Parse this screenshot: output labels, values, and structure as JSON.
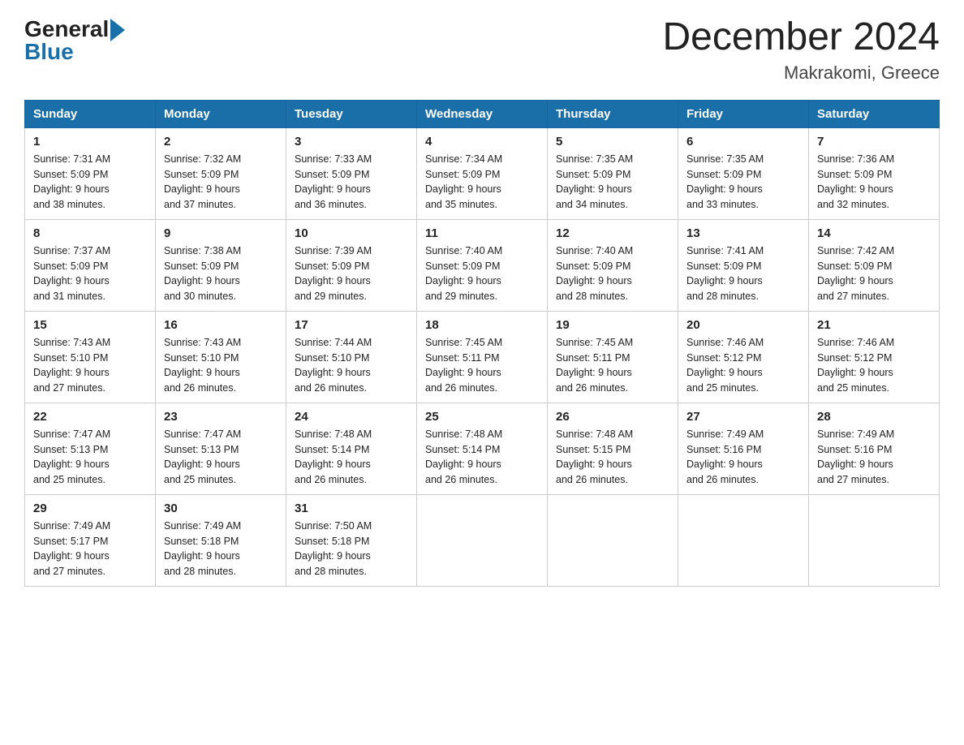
{
  "logo": {
    "general": "General",
    "blue": "Blue"
  },
  "title": "December 2024",
  "subtitle": "Makrakomi, Greece",
  "days_of_week": [
    "Sunday",
    "Monday",
    "Tuesday",
    "Wednesday",
    "Thursday",
    "Friday",
    "Saturday"
  ],
  "weeks": [
    [
      {
        "day": "1",
        "sunrise": "7:31 AM",
        "sunset": "5:09 PM",
        "daylight": "9 hours and 38 minutes."
      },
      {
        "day": "2",
        "sunrise": "7:32 AM",
        "sunset": "5:09 PM",
        "daylight": "9 hours and 37 minutes."
      },
      {
        "day": "3",
        "sunrise": "7:33 AM",
        "sunset": "5:09 PM",
        "daylight": "9 hours and 36 minutes."
      },
      {
        "day": "4",
        "sunrise": "7:34 AM",
        "sunset": "5:09 PM",
        "daylight": "9 hours and 35 minutes."
      },
      {
        "day": "5",
        "sunrise": "7:35 AM",
        "sunset": "5:09 PM",
        "daylight": "9 hours and 34 minutes."
      },
      {
        "day": "6",
        "sunrise": "7:35 AM",
        "sunset": "5:09 PM",
        "daylight": "9 hours and 33 minutes."
      },
      {
        "day": "7",
        "sunrise": "7:36 AM",
        "sunset": "5:09 PM",
        "daylight": "9 hours and 32 minutes."
      }
    ],
    [
      {
        "day": "8",
        "sunrise": "7:37 AM",
        "sunset": "5:09 PM",
        "daylight": "9 hours and 31 minutes."
      },
      {
        "day": "9",
        "sunrise": "7:38 AM",
        "sunset": "5:09 PM",
        "daylight": "9 hours and 30 minutes."
      },
      {
        "day": "10",
        "sunrise": "7:39 AM",
        "sunset": "5:09 PM",
        "daylight": "9 hours and 29 minutes."
      },
      {
        "day": "11",
        "sunrise": "7:40 AM",
        "sunset": "5:09 PM",
        "daylight": "9 hours and 29 minutes."
      },
      {
        "day": "12",
        "sunrise": "7:40 AM",
        "sunset": "5:09 PM",
        "daylight": "9 hours and 28 minutes."
      },
      {
        "day": "13",
        "sunrise": "7:41 AM",
        "sunset": "5:09 PM",
        "daylight": "9 hours and 28 minutes."
      },
      {
        "day": "14",
        "sunrise": "7:42 AM",
        "sunset": "5:09 PM",
        "daylight": "9 hours and 27 minutes."
      }
    ],
    [
      {
        "day": "15",
        "sunrise": "7:43 AM",
        "sunset": "5:10 PM",
        "daylight": "9 hours and 27 minutes."
      },
      {
        "day": "16",
        "sunrise": "7:43 AM",
        "sunset": "5:10 PM",
        "daylight": "9 hours and 26 minutes."
      },
      {
        "day": "17",
        "sunrise": "7:44 AM",
        "sunset": "5:10 PM",
        "daylight": "9 hours and 26 minutes."
      },
      {
        "day": "18",
        "sunrise": "7:45 AM",
        "sunset": "5:11 PM",
        "daylight": "9 hours and 26 minutes."
      },
      {
        "day": "19",
        "sunrise": "7:45 AM",
        "sunset": "5:11 PM",
        "daylight": "9 hours and 26 minutes."
      },
      {
        "day": "20",
        "sunrise": "7:46 AM",
        "sunset": "5:12 PM",
        "daylight": "9 hours and 25 minutes."
      },
      {
        "day": "21",
        "sunrise": "7:46 AM",
        "sunset": "5:12 PM",
        "daylight": "9 hours and 25 minutes."
      }
    ],
    [
      {
        "day": "22",
        "sunrise": "7:47 AM",
        "sunset": "5:13 PM",
        "daylight": "9 hours and 25 minutes."
      },
      {
        "day": "23",
        "sunrise": "7:47 AM",
        "sunset": "5:13 PM",
        "daylight": "9 hours and 25 minutes."
      },
      {
        "day": "24",
        "sunrise": "7:48 AM",
        "sunset": "5:14 PM",
        "daylight": "9 hours and 26 minutes."
      },
      {
        "day": "25",
        "sunrise": "7:48 AM",
        "sunset": "5:14 PM",
        "daylight": "9 hours and 26 minutes."
      },
      {
        "day": "26",
        "sunrise": "7:48 AM",
        "sunset": "5:15 PM",
        "daylight": "9 hours and 26 minutes."
      },
      {
        "day": "27",
        "sunrise": "7:49 AM",
        "sunset": "5:16 PM",
        "daylight": "9 hours and 26 minutes."
      },
      {
        "day": "28",
        "sunrise": "7:49 AM",
        "sunset": "5:16 PM",
        "daylight": "9 hours and 27 minutes."
      }
    ],
    [
      {
        "day": "29",
        "sunrise": "7:49 AM",
        "sunset": "5:17 PM",
        "daylight": "9 hours and 27 minutes."
      },
      {
        "day": "30",
        "sunrise": "7:49 AM",
        "sunset": "5:18 PM",
        "daylight": "9 hours and 28 minutes."
      },
      {
        "day": "31",
        "sunrise": "7:50 AM",
        "sunset": "5:18 PM",
        "daylight": "9 hours and 28 minutes."
      },
      null,
      null,
      null,
      null
    ]
  ]
}
